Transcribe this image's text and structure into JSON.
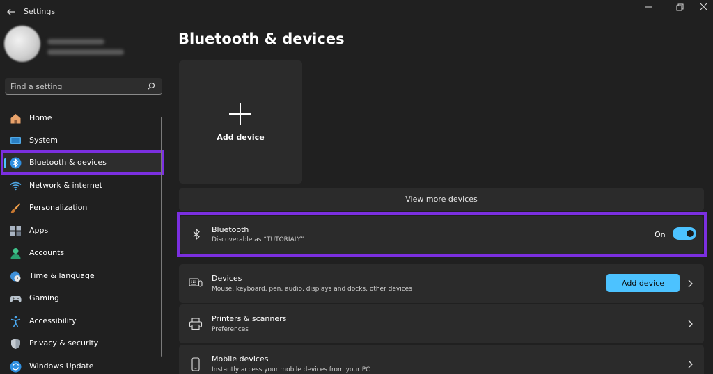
{
  "window": {
    "title": "Settings"
  },
  "search": {
    "placeholder": "Find a setting"
  },
  "nav": {
    "items": [
      {
        "label": "Home"
      },
      {
        "label": "System"
      },
      {
        "label": "Bluetooth & devices"
      },
      {
        "label": "Network & internet"
      },
      {
        "label": "Personalization"
      },
      {
        "label": "Apps"
      },
      {
        "label": "Accounts"
      },
      {
        "label": "Time & language"
      },
      {
        "label": "Gaming"
      },
      {
        "label": "Accessibility"
      },
      {
        "label": "Privacy & security"
      },
      {
        "label": "Windows Update"
      }
    ]
  },
  "main": {
    "title": "Bluetooth & devices",
    "add_tile_label": "Add device",
    "view_more": "View more devices",
    "bluetooth": {
      "title": "Bluetooth",
      "subtitle": "Discoverable as “TUTORIALY”",
      "state": "On",
      "enabled": true
    },
    "devices": {
      "title": "Devices",
      "subtitle": "Mouse, keyboard, pen, audio, displays and docks, other devices",
      "button": "Add device"
    },
    "printers": {
      "title": "Printers & scanners",
      "subtitle": "Preferences"
    },
    "mobile": {
      "title": "Mobile devices",
      "subtitle": "Instantly access your mobile devices from your PC"
    }
  },
  "colors": {
    "accent": "#4cc2ff",
    "highlight": "#7b2fe0",
    "background": "#202020",
    "card": "#2b2b2b"
  }
}
